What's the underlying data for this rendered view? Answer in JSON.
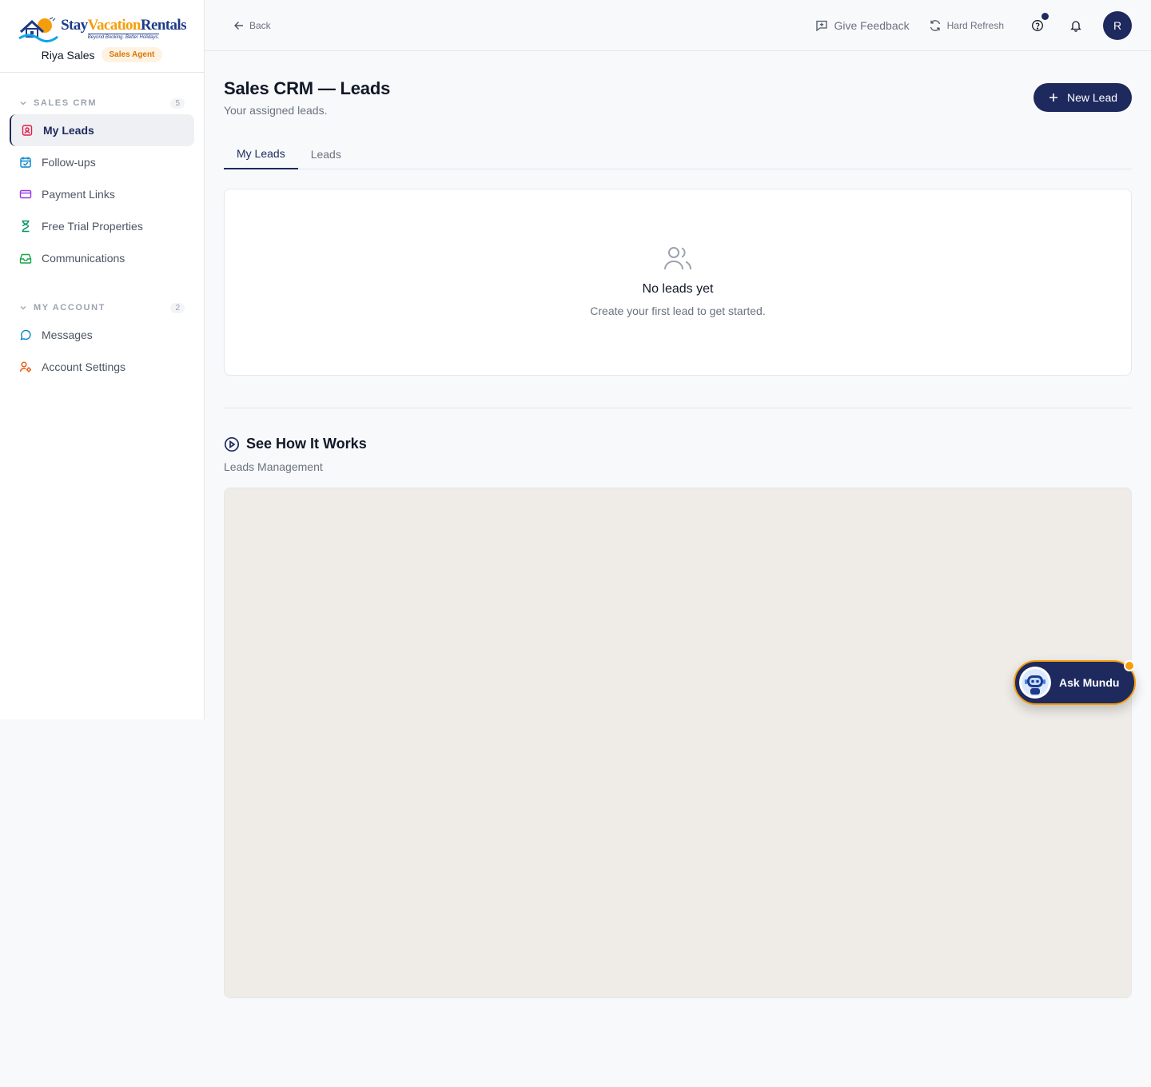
{
  "brand": {
    "logo_stay": "Stay",
    "logo_vacation": "Vacation",
    "logo_rentals": "Rentals",
    "tagline": "Beyond Booking. Better Holidays.",
    "user_name": "Riya Sales",
    "role": "Sales Agent"
  },
  "sidebar": {
    "sections": [
      {
        "label": "SALES CRM",
        "count": "5",
        "items": [
          {
            "label": "My Leads",
            "icon": "contact-icon",
            "color": "#e11d48",
            "active": true
          },
          {
            "label": "Follow-ups",
            "icon": "calendar-check-icon",
            "color": "#0284c7"
          },
          {
            "label": "Payment Links",
            "icon": "credit-card-icon",
            "color": "#9333ea"
          },
          {
            "label": "Free Trial Properties",
            "icon": "hourglass-icon",
            "color": "#059669"
          },
          {
            "label": "Communications",
            "icon": "inbox-icon",
            "color": "#16a34a"
          }
        ]
      },
      {
        "label": "MY ACCOUNT",
        "count": "2",
        "items": [
          {
            "label": "Messages",
            "icon": "message-circle-icon",
            "color": "#0284c7"
          },
          {
            "label": "Account Settings",
            "icon": "user-cog-icon",
            "color": "#ea580c"
          }
        ]
      }
    ]
  },
  "topbar": {
    "back": "Back",
    "feedback": "Give Feedback",
    "refresh": "Hard Refresh",
    "avatar_initial": "R"
  },
  "page": {
    "title": "Sales CRM — Leads",
    "subtitle": "Your assigned leads.",
    "new_lead": "New Lead",
    "tabs": [
      "My Leads",
      "Leads"
    ],
    "active_tab": "My Leads",
    "empty_title": "No leads yet",
    "empty_sub": "Create your first lead to get started.",
    "how_title": "See How It Works",
    "how_sub": "Leads Management"
  },
  "assistant": {
    "label": "Ask Mundu"
  },
  "colors": {
    "primary": "#1e2a5e",
    "accent": "#f59e0b"
  }
}
